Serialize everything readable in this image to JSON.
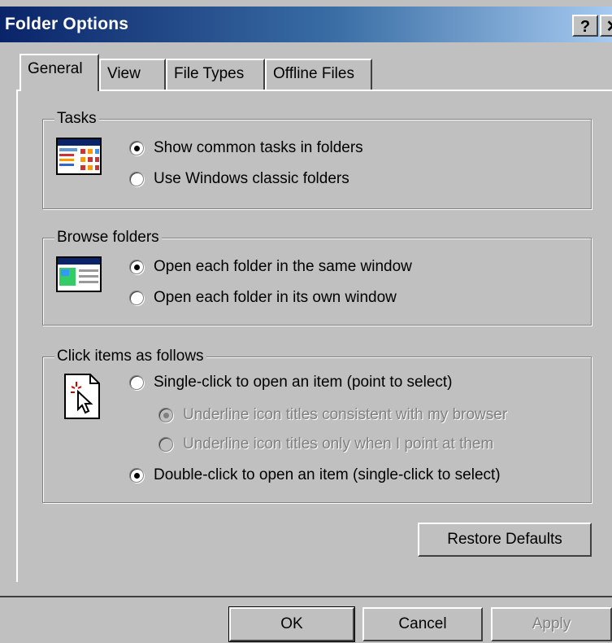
{
  "window": {
    "title": "Folder Options",
    "help_label": "?",
    "close_label": "✕"
  },
  "tabs": [
    {
      "label": "General",
      "active": true
    },
    {
      "label": "View",
      "active": false
    },
    {
      "label": "File Types",
      "active": false
    },
    {
      "label": "Offline Files",
      "active": false
    }
  ],
  "tasks": {
    "label": "Tasks",
    "icon": "web-view-folder-icon",
    "options": [
      {
        "label": "Show common tasks in folders",
        "selected": true
      },
      {
        "label": "Use Windows classic folders",
        "selected": false
      }
    ]
  },
  "browse": {
    "label": "Browse folders",
    "icon": "folder-window-icon",
    "options": [
      {
        "label": "Open each folder in the same window",
        "selected": true
      },
      {
        "label": "Open each folder in its own window",
        "selected": false
      }
    ]
  },
  "click": {
    "label": "Click items as follows",
    "icon": "pointer-click-icon",
    "options": [
      {
        "label": "Single-click to open an item (point to select)",
        "selected": false
      },
      {
        "label": "Underline icon titles consistent with my browser",
        "selected": true,
        "disabled": true
      },
      {
        "label": "Underline icon titles only when I point at them",
        "selected": false,
        "disabled": true
      },
      {
        "label": "Double-click to open an item (single-click to select)",
        "selected": true
      }
    ]
  },
  "buttons": {
    "restore": "Restore Defaults",
    "ok": "OK",
    "cancel": "Cancel",
    "apply": "Apply"
  }
}
